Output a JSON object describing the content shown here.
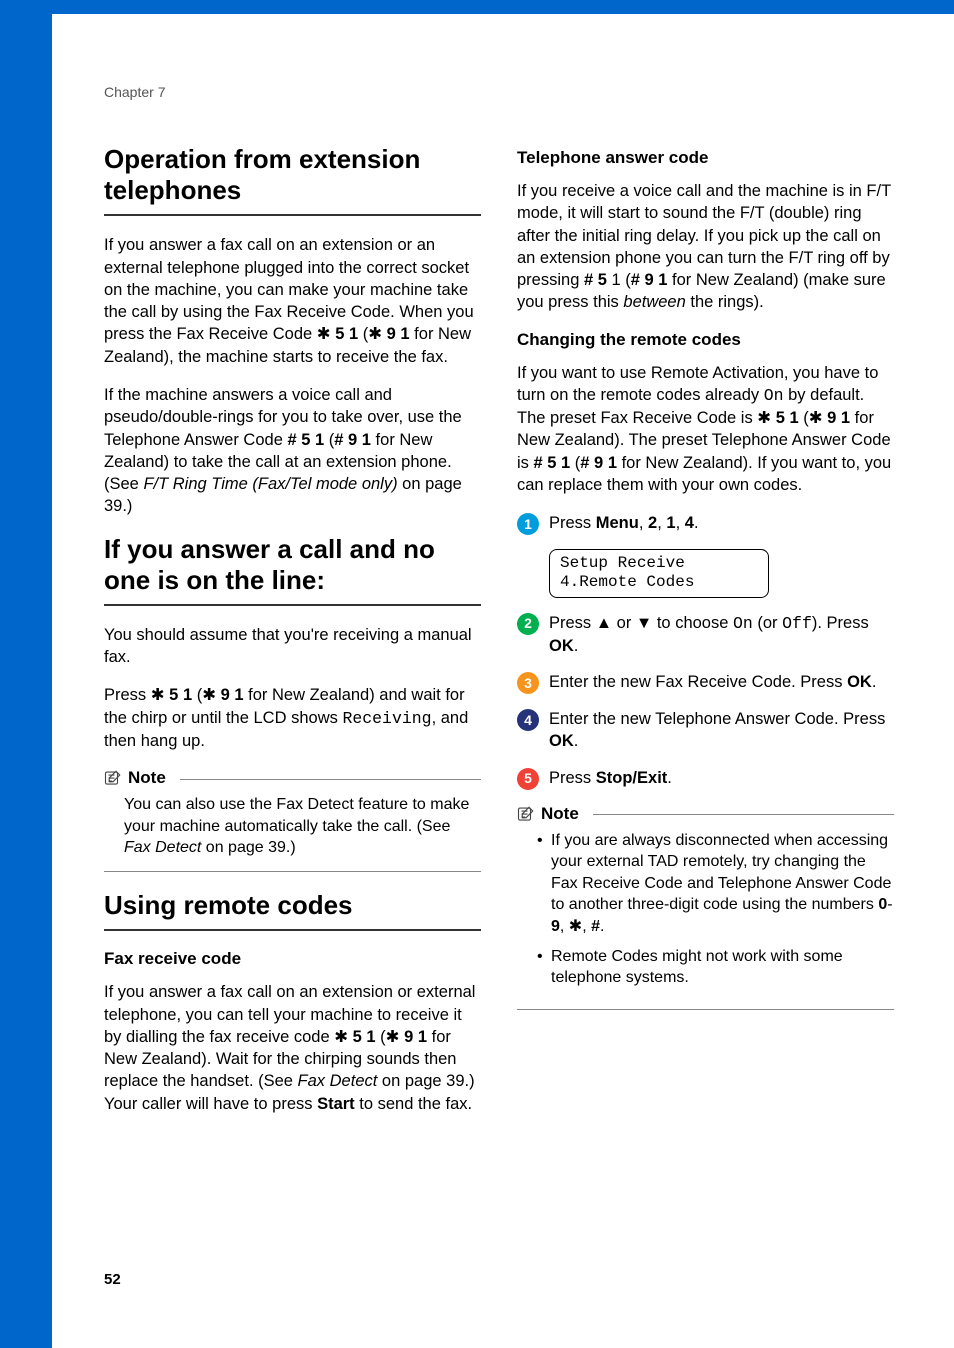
{
  "chapter": "Chapter 7",
  "left": {
    "h1": "Operation from extension telephones",
    "p1_pre": "If you answer a fax call on an extension or an external telephone plugged into the correct socket on the machine, you can make your machine take the call by using the Fax Receive Code. When you press the Fax Receive Code ",
    "star": "✱",
    "code51": " 5 1",
    "paren_open": " (",
    "code91": " 9 1",
    "p1_post": " for New Zealand), the machine starts to receive the fax.",
    "p2_a": "If the machine answers a voice call and pseudo/double-rings for you to take over, use the Telephone Answer Code ",
    "p2_b": "# 5 1",
    "p2_c": " (",
    "p2_d": "# 9 1",
    "p2_e": " for New Zealand) to take the call at an extension phone. (See ",
    "p2_f": "F/T Ring Time (Fax/Tel mode only)",
    "p2_g": " on page 39.)",
    "h2": "If you answer a call and no one is on the line:",
    "p3": "You should assume that you're receiving a manual fax.",
    "p4_a": "Press ",
    "p4_b": " 5 1",
    "p4_c": " (",
    "p4_d": " 9 1",
    "p4_e": " for New Zealand) and wait for the chirp or until the LCD shows ",
    "p4_f": "Receiving",
    "p4_g": ", and then hang up.",
    "note_label": "Note",
    "note1_a": "You can also use the Fax Detect feature to make your machine automatically take the call. (See ",
    "note1_b": "Fax Detect",
    "note1_c": " on page 39.)",
    "h3": "Using remote codes",
    "sub1": "Fax receive code",
    "p5_a": "If you answer a fax call on an extension or external telephone, you can tell your machine to receive it by dialling the fax receive code ",
    "p5_b": " 5 1",
    "p5_c": " (",
    "p5_d": " 9 1",
    "p5_e": " for New Zealand). Wait for the chirping sounds then replace the handset. (See ",
    "p5_f": "Fax Detect",
    "p5_g": " on page 39.) Your caller will have to press ",
    "p5_h": "Start",
    "p5_i": " to send the fax."
  },
  "right": {
    "sub1": "Telephone answer code",
    "p1_a": "If you receive a voice call and the machine is in F/T mode, it will start to sound the F/T (double) ring after the initial ring delay. If you pick up the call on an extension phone you can turn the F/T ring off by pressing ",
    "p1_b": "# 5",
    "p1_c": " 1 (",
    "p1_d": "# 9 1",
    "p1_e": " for New Zealand) (make sure you press this ",
    "p1_f": "between",
    "p1_g": " the rings).",
    "sub2": "Changing the remote codes",
    "p2_a": "If you want to use Remote Activation, you have to turn on the remote codes already ",
    "p2_b": "On",
    "p2_c": " by default. The preset Fax Receive Code is ",
    "p2_d": " 5 1",
    "p2_e": " (",
    "p2_f": " 9 1",
    "p2_g": " for New Zealand). The preset Telephone Answer Code is ",
    "p2_h": "# 5 1",
    "p2_i": " (",
    "p2_j": "# 9 1",
    "p2_k": " for New Zealand). If you want to, you can replace them with your own codes.",
    "step1_a": "Press ",
    "step1_b": "Menu",
    "step1_c": ", ",
    "step1_d": "2",
    "step1_e": ", ",
    "step1_f": "1",
    "step1_g": ", ",
    "step1_h": "4",
    "step1_i": ".",
    "lcd_l1": "Setup Receive",
    "lcd_l2": "4.Remote Codes",
    "step2_a": "Press ▲ or ▼ to choose ",
    "step2_b": "On",
    "step2_c": " (or ",
    "step2_d": "Off",
    "step2_e": "). Press ",
    "step2_f": "OK",
    "step2_g": ".",
    "step3_a": "Enter the new Fax Receive Code. Press ",
    "step3_b": "OK",
    "step3_c": ".",
    "step4_a": "Enter the new Telephone Answer Code. Press ",
    "step4_b": "OK",
    "step4_c": ".",
    "step5_a": "Press ",
    "step5_b": "Stop/Exit",
    "step5_c": ".",
    "note_label": "Note",
    "note2_li1_a": "If you are always disconnected when accessing your external TAD remotely, try changing the Fax Receive Code and Telephone Answer Code to another three-digit code using the numbers ",
    "note2_li1_b": "0",
    "note2_li1_c": "-",
    "note2_li1_d": "9",
    "note2_li1_e": ", ",
    "note2_li1_f": ", ",
    "note2_li1_g": "#",
    "note2_li1_h": ".",
    "note2_li2": "Remote Codes might not work with some telephone systems."
  },
  "page_number": "52",
  "star_char": "✱"
}
